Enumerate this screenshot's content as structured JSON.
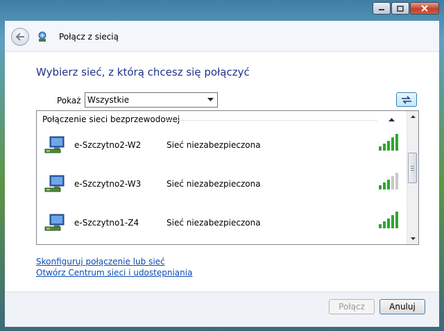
{
  "window": {
    "title": "Połącz z siecią",
    "controls": [
      "minimize",
      "maximize",
      "close"
    ]
  },
  "main": {
    "heading": "Wybierz sieć, z którą chcesz się połączyć",
    "filter": {
      "label": "Pokaż",
      "selected": "Wszystkie"
    },
    "group_label": "Połączenie sieci bezprzewodowej",
    "networks": [
      {
        "name": "e-Szczytno2-W2",
        "status": "Sieć niezabezpieczona",
        "signal_bars": 5
      },
      {
        "name": "e-Szczytno2-W3",
        "status": "Sieć niezabezpieczona",
        "signal_bars": 3
      },
      {
        "name": "e-Szczytno1-Z4",
        "status": "Sieć niezabezpieczona",
        "signal_bars": 5
      }
    ]
  },
  "links": {
    "configure": "Skonfiguruj połączenie lub sieć",
    "network_center": "Otwórz Centrum sieci i udostępniania"
  },
  "buttons": {
    "connect": "Połącz",
    "cancel": "Anuluj"
  },
  "colors": {
    "heading": "#1e3287",
    "link": "#0b4bb3",
    "signal_on": "#2fa62f",
    "signal_off": "#c8c8c8"
  }
}
